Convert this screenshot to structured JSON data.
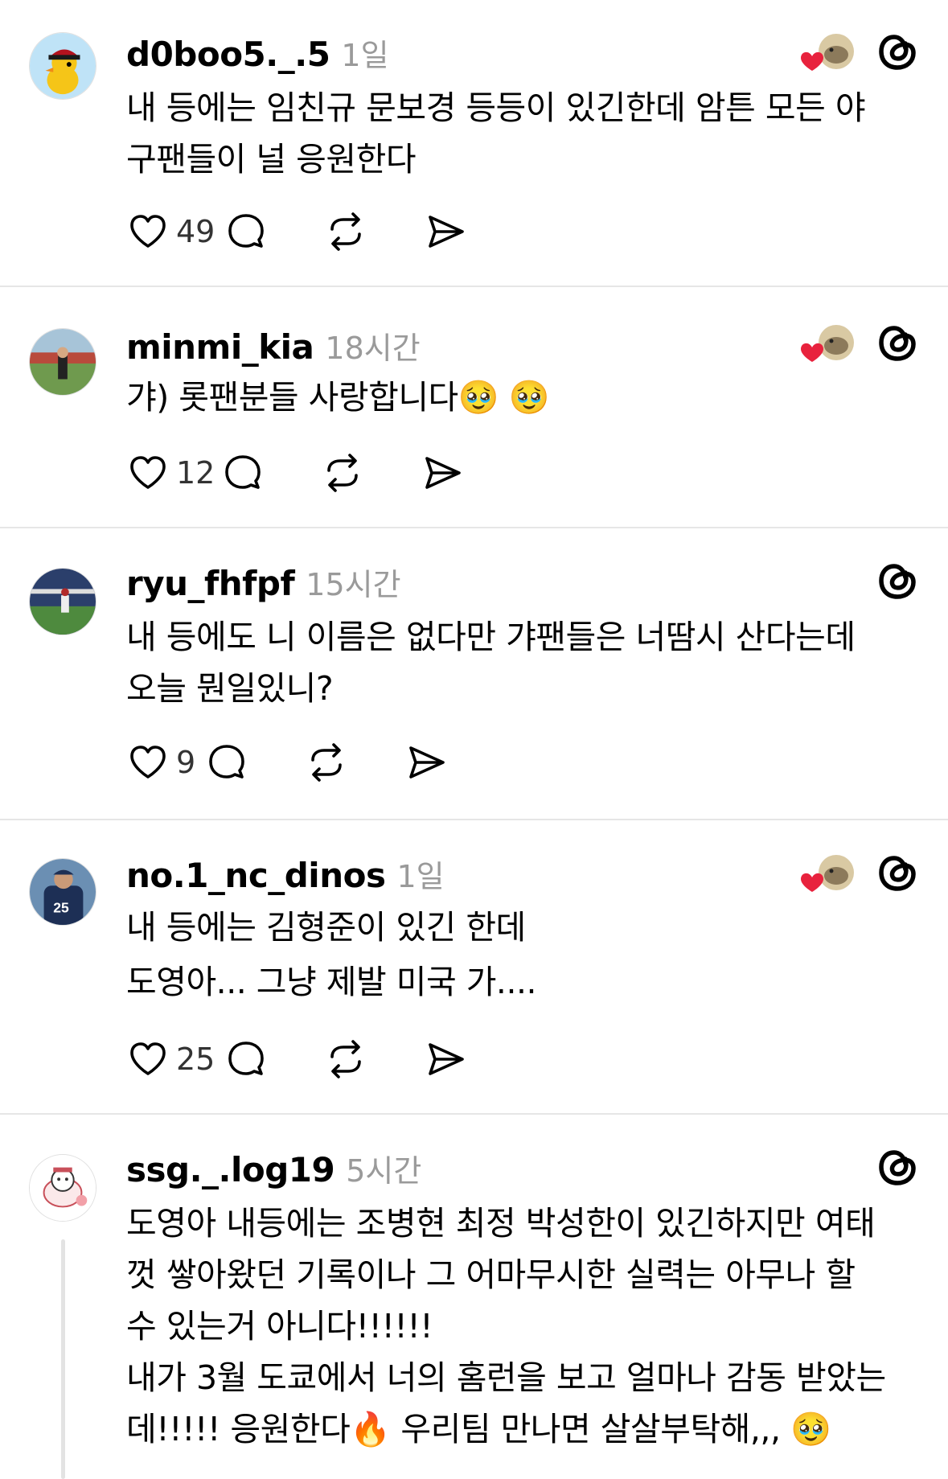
{
  "posts": [
    {
      "username": "d0boo5._.5",
      "time": "1일",
      "text": "내 등에는 임친규 문보경 등등이 있긴한데 암튼 모든 야\n구팬들이 널 응원한다",
      "likes": "49",
      "liked_by_author": true
    },
    {
      "username": "minmi_kia",
      "time": "18시간",
      "text": "갸) 롯팬분들 사랑합니다🥹 🥹",
      "likes": "12",
      "liked_by_author": true
    },
    {
      "username": "ryu_fhfpf",
      "time": "15시간",
      "text": "내 등에도 니 이름은 없다만 갸팬들은 너땀시 산다는데\n오늘 뭔일있니?",
      "likes": "9",
      "liked_by_author": false
    },
    {
      "username": "no.1_nc_dinos",
      "time": "1일",
      "text": "내 등에는 김형준이 있긴 한데\n도영아... 그냥 제발 미국 가....",
      "likes": "25",
      "liked_by_author": true
    },
    {
      "username": "ssg._.log19",
      "time": "5시간",
      "text": "도영아 내등에는 조병현 최정 박성한이 있긴하지만 여태\n껏 쌓아왔던 기록이나 그 어마무시한 실력는 아무나 할\n수 있는거 아니다!!!!!!\n내가 3월 도쿄에서 너의 홈런을 보고 얼마나 감동 받았는\n데!!!!! 응원한다🔥 우리팀 만나면 살살부탁해,,, 🥹",
      "likes": "",
      "liked_by_author": false
    }
  ],
  "icons": {
    "like": "heart-icon",
    "reply": "comment-bubble-icon",
    "repost": "repost-icon",
    "share": "send-icon",
    "threads": "threads-logo-icon",
    "liked_by": "liked-by-author-icon"
  },
  "colors": {
    "heart_red": "#e8223d",
    "muted_text": "#9a9a9a",
    "divider": "#e6e6e6"
  }
}
